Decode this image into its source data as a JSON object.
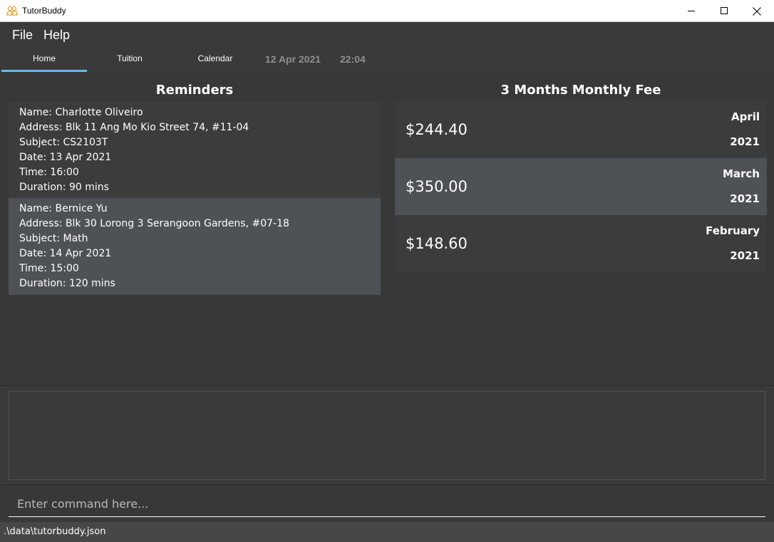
{
  "window": {
    "title": "TutorBuddy",
    "icon": "people-icon",
    "controls": [
      "minimize-icon",
      "maximize-icon",
      "close-icon"
    ]
  },
  "menu": {
    "items": [
      "File",
      "Help"
    ]
  },
  "tabs": {
    "items": [
      "Home",
      "Tuition",
      "Calendar"
    ],
    "active": "Home",
    "accent_color": "#6ab8e8"
  },
  "clock": {
    "date": "12 Apr 2021",
    "time": "22:04"
  },
  "reminders": {
    "title": "Reminders",
    "items": [
      {
        "name": "Name: Charlotte Oliveiro",
        "address": "Address: Blk 11 Ang Mo Kio Street 74, #11-04",
        "subject": "Subject: CS2103T",
        "date": "Date: 13 Apr 2021",
        "time": "Time: 16:00",
        "duration": "Duration: 90 mins"
      },
      {
        "name": "Name: Bernice Yu",
        "address": "Address: Blk 30 Lorong 3 Serangoon Gardens, #07-18",
        "subject": "Subject: Math",
        "date": "Date: 14 Apr 2021",
        "time": "Time: 15:00",
        "duration": "Duration: 120 mins"
      }
    ]
  },
  "fees": {
    "title": "3 Months Monthly Fee",
    "items": [
      {
        "amount": "$244.40",
        "month": "April",
        "year": "2021"
      },
      {
        "amount": "$350.00",
        "month": "March",
        "year": "2021"
      },
      {
        "amount": "$148.60",
        "month": "February",
        "year": "2021"
      }
    ]
  },
  "result": {
    "text": ""
  },
  "command": {
    "placeholder": "Enter command here...",
    "value": ""
  },
  "status": {
    "path": ".\\data\\tutorbuddy.json"
  }
}
